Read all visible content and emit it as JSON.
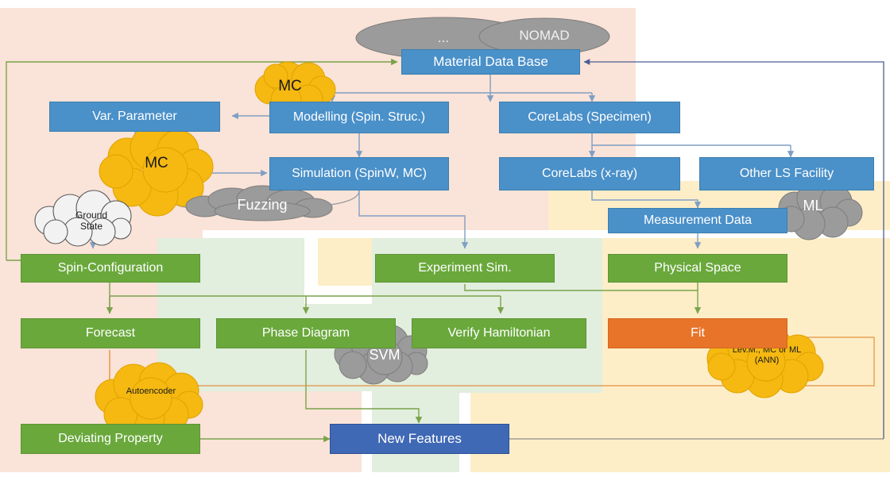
{
  "diagram": {
    "title_present": false,
    "colors": {
      "blue": "#4a90c9",
      "blue_dark": "#3f68b5",
      "green": "#6aa83c",
      "orange": "#e8742a",
      "cloud_yellow": "#f5b911",
      "cloud_gray": "#9b9b9b",
      "cloud_white": "#f2f2f2",
      "panel_peach": "#fae3d8",
      "panel_green": "#e2eede",
      "panel_yellow": "#fdeec8",
      "arrow_blue": "#7f9fc4",
      "arrow_green": "#7aa34a",
      "arrow_orange": "#e2923f",
      "arrow_gray": "#9aa0a6"
    },
    "panels": [
      {
        "name": "theory-panel",
        "color": "#fae3d8"
      },
      {
        "name": "simulation-panel",
        "color": "#e2eede"
      },
      {
        "name": "experiment-panel",
        "color": "#fdeec8"
      }
    ],
    "databases": [
      {
        "name": "db-ellipse-left",
        "label": "..."
      },
      {
        "name": "db-ellipse-right",
        "label": "NOMAD"
      }
    ],
    "nodes": [
      {
        "id": "material-data-base",
        "label": "Material Data Base",
        "style": "blue"
      },
      {
        "id": "var-parameter",
        "label": "Var. Parameter",
        "style": "blue"
      },
      {
        "id": "modelling",
        "label": "Modelling (Spin. Struc.)",
        "style": "blue"
      },
      {
        "id": "simulation",
        "label": "Simulation (SpinW, MC)",
        "style": "blue"
      },
      {
        "id": "corelabs-specimen",
        "label": "CoreLabs (Specimen)",
        "style": "blue"
      },
      {
        "id": "corelabs-xray",
        "label": "CoreLabs (x-ray)",
        "style": "blue"
      },
      {
        "id": "other-ls-facility",
        "label": "Other LS Facility",
        "style": "blue"
      },
      {
        "id": "measurement-data",
        "label": "Measurement Data",
        "style": "blue"
      },
      {
        "id": "spin-configuration",
        "label": "Spin-Configuration",
        "style": "green"
      },
      {
        "id": "experiment-sim",
        "label": "Experiment Sim.",
        "style": "green"
      },
      {
        "id": "physical-space",
        "label": "Physical Space",
        "style": "green"
      },
      {
        "id": "forecast",
        "label": "Forecast",
        "style": "green"
      },
      {
        "id": "phase-diagram",
        "label": "Phase Diagram",
        "style": "green"
      },
      {
        "id": "verify-hamiltonian",
        "label": "Verify Hamiltonian",
        "style": "green"
      },
      {
        "id": "fit",
        "label": "Fit",
        "style": "orange"
      },
      {
        "id": "deviating-property",
        "label": "Deviating Property",
        "style": "green"
      },
      {
        "id": "new-features",
        "label": "New Features",
        "style": "blue_dark"
      }
    ],
    "clouds": [
      {
        "id": "mc-top",
        "label": "MC",
        "style": "yellow"
      },
      {
        "id": "mc-left",
        "label": "MC",
        "style": "yellow"
      },
      {
        "id": "fuzzing",
        "label": "Fuzzing",
        "style": "gray"
      },
      {
        "id": "ground-state",
        "label": "Ground\nState",
        "line1": "Ground",
        "line2": "State",
        "style": "white"
      },
      {
        "id": "ml",
        "label": "ML",
        "style": "gray"
      },
      {
        "id": "svm",
        "label": "SVM",
        "style": "gray"
      },
      {
        "id": "levm-mc-ml",
        "line1": "Lev.M., MC or ML",
        "line2": "(ANN)",
        "style": "yellow"
      },
      {
        "id": "autoencoder",
        "label": "Autoencoder",
        "style": "yellow"
      }
    ]
  }
}
